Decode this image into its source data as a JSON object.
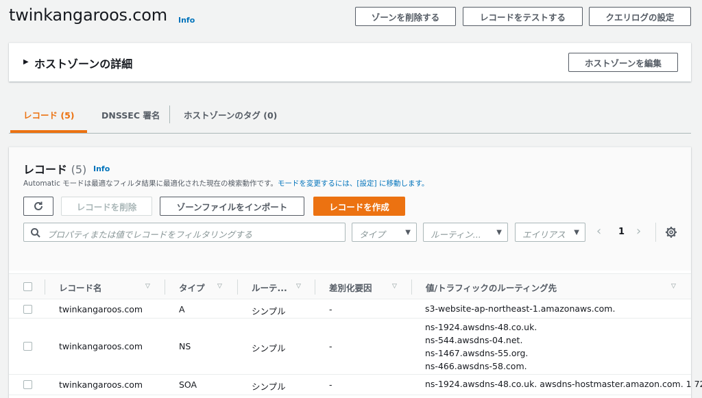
{
  "header": {
    "title": "twinkangaroos.com",
    "info": "Info",
    "buttons": {
      "delete_zone": "ゾーンを削除する",
      "test_record": "レコードをテストする",
      "query_log": "クエリログの設定"
    }
  },
  "details": {
    "title": "ホストゾーンの詳細",
    "edit_button": "ホストゾーンを編集"
  },
  "tabs": {
    "records": "レコード (5)",
    "dnssec": "DNSSEC 署名",
    "tags": "ホストゾーンのタグ (0)"
  },
  "records": {
    "title": "レコード",
    "count": "(5)",
    "info": "Info",
    "desc_prefix": "Automatic モードは最適なフィルタ結果に最適化された現在の検索動作です。",
    "desc_link": "モードを変更するには、[設定] に移動します。",
    "buttons": {
      "delete": "レコードを削除",
      "import": "ゾーンファイルをインポート",
      "create": "レコードを作成"
    },
    "search_placeholder": "プロパティまたは値でレコードをフィルタリングする",
    "filters": {
      "type": "タイプ",
      "routing": "ルーティン...",
      "alias": "エイリアス"
    },
    "page": "1"
  },
  "table": {
    "columns": {
      "name": "レコード名",
      "type": "タイプ",
      "routing": "ルーテ...",
      "diff": "差別化要因",
      "value": "値/トラフィックのルーティング先"
    },
    "rows": [
      {
        "name": "twinkangaroos.com",
        "type": "A",
        "routing": "シンプル",
        "diff": "-",
        "values": [
          "s3-website-ap-northeast-1.amazonaws.com."
        ]
      },
      {
        "name": "twinkangaroos.com",
        "type": "NS",
        "routing": "シンプル",
        "diff": "-",
        "values": [
          "ns-1924.awsdns-48.co.uk.",
          "ns-544.awsdns-04.net.",
          "ns-1467.awsdns-55.org.",
          "ns-466.awsdns-58.com."
        ]
      },
      {
        "name": "twinkangaroos.com",
        "type": "SOA",
        "routing": "シンプル",
        "diff": "-",
        "values": [
          "ns-1924.awsdns-48.co.uk. awsdns-hostmaster.amazon.com. 1 72"
        ]
      }
    ]
  },
  "colors": {
    "accent": "#ec7211",
    "link": "#0073bb",
    "text": "#16191f",
    "secondary_text": "#545b64"
  }
}
